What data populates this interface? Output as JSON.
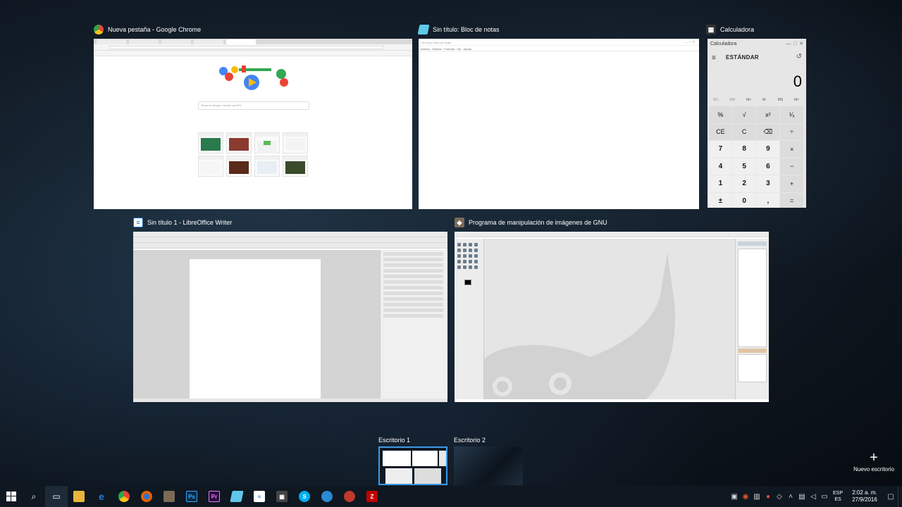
{
  "windows": {
    "chrome": {
      "title": "Nueva pestaña - Google Chrome",
      "search_placeholder": "Busca en Google o escribe una URL"
    },
    "notepad": {
      "title": "Sin título: Bloc de notas",
      "inner_title": "Sin título: Bloc de notas",
      "menu": [
        "Archivo",
        "Edición",
        "Formato",
        "Ver",
        "Ayuda"
      ]
    },
    "calculator": {
      "title": "Calculadora",
      "inner_title": "Calculadora",
      "mode": "ESTÁNDAR",
      "display": "0",
      "memory": [
        "MC",
        "MR",
        "M+",
        "M-",
        "MS",
        "M˅"
      ],
      "keys": [
        "%",
        "√",
        "x²",
        "¹⁄ₓ",
        "CE",
        "C",
        "⌫",
        "÷",
        "7",
        "8",
        "9",
        "×",
        "4",
        "5",
        "6",
        "−",
        "1",
        "2",
        "3",
        "+",
        "±",
        "0",
        ",",
        "="
      ]
    },
    "writer": {
      "title": "Sin título 1 - LibreOffice Writer"
    },
    "gimp": {
      "title": "Programa de manipulación de imágenes de GNU"
    }
  },
  "desktops": {
    "items": [
      {
        "label": "Escritorio 1",
        "active": true
      },
      {
        "label": "Escritorio 2",
        "active": false
      }
    ],
    "new_label": "Nuevo escritorio"
  },
  "taskbar": {
    "apps": [
      {
        "name": "task-view",
        "glyph": "▭"
      },
      {
        "name": "file-explorer",
        "color": "#e8b53a"
      },
      {
        "name": "edge",
        "color": "#1f7fd6",
        "glyph": "e"
      },
      {
        "name": "chrome",
        "color": "#e7453b"
      },
      {
        "name": "firefox",
        "color": "#e66000"
      },
      {
        "name": "gimp",
        "color": "#7b6a55"
      },
      {
        "name": "photoshop",
        "color": "#0b2a44",
        "glyph": "Ps"
      },
      {
        "name": "premiere",
        "color": "#2a0a3d",
        "glyph": "Pr"
      },
      {
        "name": "notepad",
        "color": "#5fc8e8"
      },
      {
        "name": "writer",
        "color": "#1c6fc2"
      },
      {
        "name": "calculator",
        "color": "#444"
      },
      {
        "name": "skype",
        "color": "#00aff0",
        "glyph": "S"
      },
      {
        "name": "chat",
        "color": "#2a8ad4"
      },
      {
        "name": "game",
        "color": "#c0392b"
      },
      {
        "name": "filezilla",
        "color": "#bf0000",
        "glyph": "Z"
      }
    ],
    "lang_top": "ESP",
    "lang_bottom": "ES",
    "time": "2:02 a. m.",
    "date": "27/9/2016"
  }
}
